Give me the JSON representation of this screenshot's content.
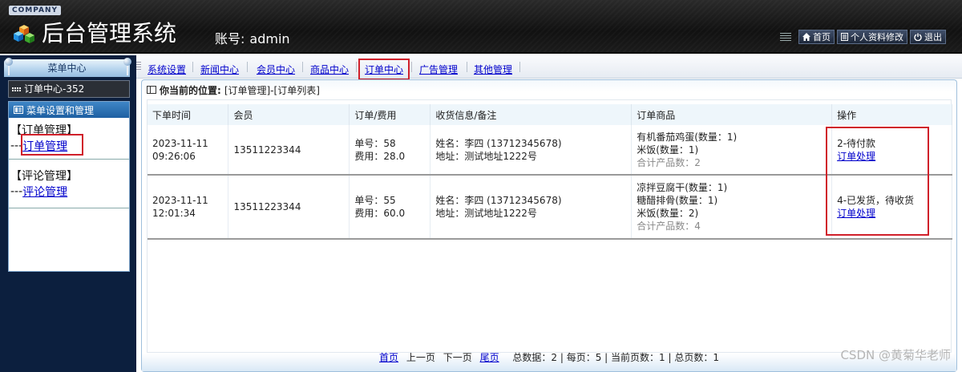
{
  "header": {
    "company": "COMPANY",
    "title": "后台管理系统",
    "account_label": "账号:",
    "account_value": "admin",
    "buttons": {
      "home": "首页",
      "profile": "个人资料修改",
      "logout": "退出"
    }
  },
  "sidebar": {
    "menu_center": "菜单中心",
    "current": "订单中心-352",
    "settings_header": "菜单设置和管理",
    "groups": [
      {
        "title": "【订单管理】",
        "prefix": "---",
        "link": "订单管理"
      },
      {
        "title": "【评论管理】",
        "prefix": "---",
        "link": "评论管理"
      }
    ]
  },
  "topnav": {
    "items": [
      "系统设置",
      "新闻中心",
      "会员中心",
      "商品中心",
      "订单中心",
      "广告管理",
      "其他管理"
    ]
  },
  "breadcrumb": {
    "label": "你当前的位置:",
    "path": "[订单管理]-[订单列表]"
  },
  "table": {
    "headers": [
      "下单时间",
      "会员",
      "订单/费用",
      "收货信息/备注",
      "订单商品",
      "操作"
    ],
    "rows": [
      {
        "date": "2023-11-11",
        "time": "09:26:06",
        "member": "13511223344",
        "order_no": "单号：58",
        "fee": "费用：28.0",
        "name": "姓名：李四 (13712345678)",
        "address": "地址：测试地址1222号",
        "items": [
          "有机番茄鸡蛋(数量：1)",
          "米饭(数量：1)"
        ],
        "total": "合计产品数：2",
        "status": "2-待付款",
        "action": "订单处理"
      },
      {
        "date": "2023-11-11",
        "time": "12:01:34",
        "member": "13511223344",
        "order_no": "单号：55",
        "fee": "费用：60.0",
        "name": "姓名：李四 (13712345678)",
        "address": "地址：测试地址1222号",
        "items": [
          "凉拌豆腐干(数量：1)",
          "糖醋排骨(数量：1)",
          "米饭(数量：2)"
        ],
        "total": "合计产品数：4",
        "status": "4-已发货，待收货",
        "action": "订单处理"
      }
    ]
  },
  "pager": {
    "first": "首页",
    "prev": "上一页",
    "next": "下一页",
    "last": "尾页",
    "summary": "总数据：2 | 每页：5 | 当前页数：1 | 总页数：1"
  },
  "watermark": "CSDN @黄菊华老师"
}
